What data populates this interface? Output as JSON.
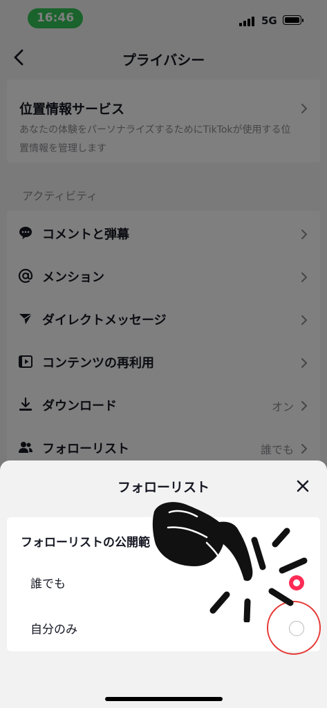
{
  "status_bar": {
    "time": "16:46",
    "network": "5G"
  },
  "nav": {
    "title": "プライバシー",
    "back_icon": "chevron-left-icon"
  },
  "location": {
    "title": "位置情報サービス",
    "description": "あなたの体験をパーソナライズするためにTikTokが使用する位置情報を管理します"
  },
  "activity": {
    "section_label": "アクティビティ",
    "items": [
      {
        "label": "コメントと弾幕",
        "icon": "comment-bubble-icon",
        "value": ""
      },
      {
        "label": "メンション",
        "icon": "at-sign-icon",
        "value": ""
      },
      {
        "label": "ダイレクトメッセージ",
        "icon": "send-arrow-icon",
        "value": ""
      },
      {
        "label": "コンテンツの再利用",
        "icon": "video-reuse-icon",
        "value": ""
      },
      {
        "label": "ダウンロード",
        "icon": "download-icon",
        "value": "オン"
      },
      {
        "label": "フォローリスト",
        "icon": "users-icon",
        "value": "誰でも"
      }
    ]
  },
  "sheet": {
    "title": "フォローリスト",
    "heading": "フォローリストの公開範",
    "options": [
      {
        "label": "誰でも",
        "selected": true
      },
      {
        "label": "自分のみ",
        "selected": false
      }
    ],
    "accent_color": "#fe2c55"
  },
  "annotation": {
    "pointer": "pointing-hand-icon",
    "highlight": "red-circle-highlight"
  }
}
